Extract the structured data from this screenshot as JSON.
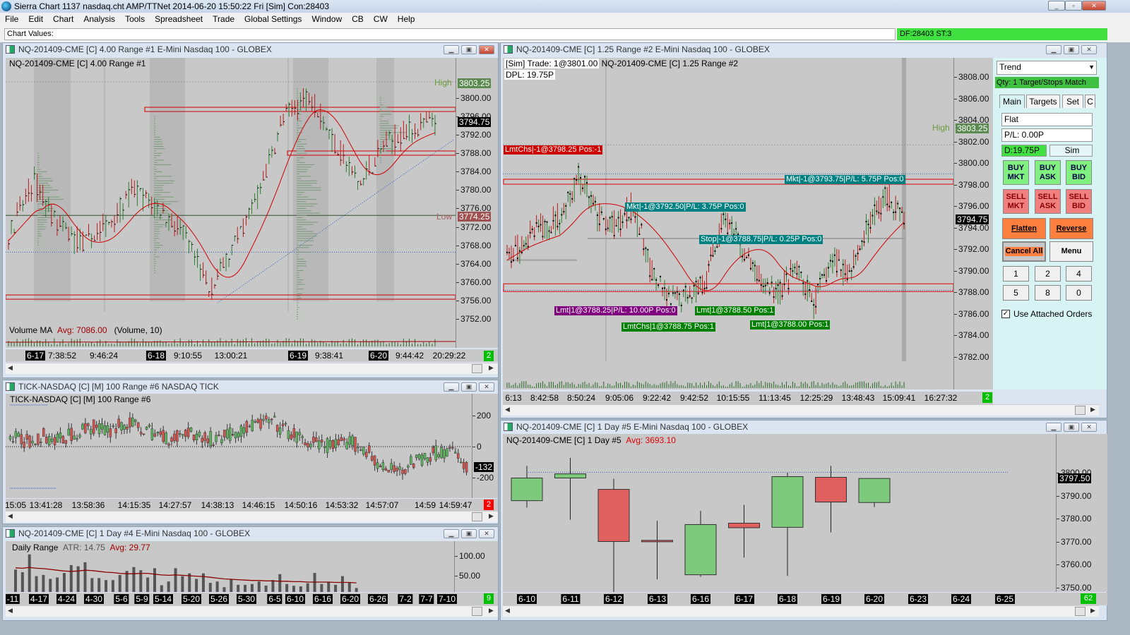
{
  "app": {
    "title": "Sierra Chart 1137 nasdaq.cht  AMP/TTNet 2014-06-20  15:50:22 Fri [Sim]  Con:28403"
  },
  "menu": [
    "File",
    "Edit",
    "Chart",
    "Analysis",
    "Tools",
    "Spreadsheet",
    "Trade",
    "Global Settings",
    "Window",
    "CB",
    "CW",
    "Help"
  ],
  "values_bar": {
    "label": "Chart Values:",
    "status": "DF:28403  ST:3"
  },
  "colors": {
    "chart_bg": "#c8c8c8",
    "up": "#2e7d32",
    "down": "#c62828",
    "candle_up": "#7dca7d",
    "candle_down": "#e06060",
    "teal": "#008080",
    "green_badge": "#00c000",
    "red_badge": "#ff0000"
  },
  "chart1": {
    "window_title": "NQ-201409-CME [C]  4.00 Range  #1  E-Mini Nasdaq 100 - GLOBEX",
    "header": "NQ-201409-CME [C]  4.00 Range  #1",
    "high_label": "High",
    "low_label": "Low",
    "y_ticks": [
      "3800.00",
      "3796.00",
      "3792.00",
      "3788.00",
      "3784.00",
      "3780.00",
      "3776.00",
      "3772.00",
      "3768.00",
      "3764.00",
      "3760.00",
      "3756.00",
      "3752.00"
    ],
    "markers": {
      "high": "3803.25",
      "last": "3794.75",
      "low": "3774.25"
    },
    "volume_label": "Volume MA",
    "volume_avg": "Avg: 7086.00",
    "volume_params": "(Volume, 10)",
    "time_labels": [
      {
        "t": "6-17",
        "d": true
      },
      {
        "t": "7:38:52"
      },
      {
        "t": "9:46:24"
      },
      {
        "t": "6-18",
        "d": true
      },
      {
        "t": "9:10:55"
      },
      {
        "t": "13:00:21"
      },
      {
        "t": "6-19",
        "d": true
      },
      {
        "t": "9:38:41"
      },
      {
        "t": "6-20",
        "d": true
      },
      {
        "t": "9:44:42"
      },
      {
        "t": "20:29:22"
      }
    ],
    "badge": "2",
    "price_path": [
      3770,
      3782,
      3772,
      3768,
      3773,
      3780,
      3776,
      3770,
      3758,
      3768,
      3780,
      3796,
      3801,
      3790,
      3781,
      3790,
      3793,
      3794.75
    ]
  },
  "chart2": {
    "window_title": "NQ-201409-CME [C]  1.25 Range  #2  E-Mini Nasdaq 100 - GLOBEX",
    "trade_text": "[Sim]  Trade: 1@3801.00",
    "header": "NQ-201409-CME [C]  1.25 Range  #2",
    "dpl": "DPL: 19.75P",
    "high_label": "High",
    "y_ticks": [
      "3808.00",
      "3806.00",
      "3804.00",
      "3802.00",
      "3800.00",
      "3798.00",
      "3796.00",
      "3794.00",
      "3792.00",
      "3790.00",
      "3788.00",
      "3786.00",
      "3784.00",
      "3782.00"
    ],
    "markers": {
      "high": "3803.25",
      "last": "3794.75"
    },
    "orders": [
      {
        "text": "LmtChs|-1@3798.25 Pos:-1",
        "color": "#d00000"
      },
      {
        "text": "Mkt|-1@3793.75|P/L: 5.75P Pos:0",
        "color": "#008080"
      },
      {
        "text": "Mkt|-1@3792.50|P/L: 3.75P Pos:0",
        "color": "#008080"
      },
      {
        "text": "Stop|-1@3788.75|P/L: 0.25P Pos:0",
        "color": "#008080"
      },
      {
        "text": "Lmt|1@3788.25|P/L: 10.00P Pos:0",
        "color": "#800080"
      },
      {
        "text": "Lmt|1@3788.50 Pos:1",
        "color": "#008000"
      },
      {
        "text": "LmtChs|1@3788.75 Pos:1",
        "color": "#008000"
      },
      {
        "text": "Lmt|1@3788.00 Pos:1",
        "color": "#008000"
      }
    ],
    "time_labels": [
      {
        "t": "6:13"
      },
      {
        "t": "8:42:58"
      },
      {
        "t": "8:50:24"
      },
      {
        "t": "9:05:06"
      },
      {
        "t": "9:22:42"
      },
      {
        "t": "9:42:52"
      },
      {
        "t": "10:15:55"
      },
      {
        "t": "11:13:45"
      },
      {
        "t": "12:25:29"
      },
      {
        "t": "13:48:43"
      },
      {
        "t": "15:09:41"
      },
      {
        "t": "16:27:32"
      }
    ],
    "badge": "2",
    "price_path": [
      3791,
      3793,
      3794,
      3795,
      3799,
      3795,
      3794,
      3796,
      3790,
      3787,
      3788,
      3789,
      3795,
      3792,
      3789,
      3788,
      3790,
      3787,
      3791,
      3790,
      3794,
      3797,
      3794.75
    ]
  },
  "trade_panel": {
    "strategy": "Trend",
    "qty_status": "Qty: 1 Target/Stops Match",
    "tabs": [
      "Main",
      "Targets",
      "Set",
      "C"
    ],
    "position": "Flat",
    "pl": "P/L: 0.00P",
    "daily": "D:19.75P",
    "mode": "Sim",
    "buttons": {
      "buy_mkt": [
        "BUY",
        "MKT"
      ],
      "buy_ask": [
        "BUY",
        "ASK"
      ],
      "buy_bid": [
        "BUY",
        "BID"
      ],
      "sell_mkt": [
        "SELL",
        "MKT"
      ],
      "sell_ask": [
        "SELL",
        "ASK"
      ],
      "sell_bid": [
        "SELL",
        "BID"
      ],
      "flatten": "Flatten",
      "reverse": "Reverse",
      "cancel_all": "Cancel All",
      "menu": "Menu"
    },
    "quantities": [
      "1",
      "2",
      "4",
      "5",
      "8",
      "0"
    ],
    "use_attached_orders": {
      "label": "Use Attached Orders",
      "checked": true
    }
  },
  "chart6": {
    "window_title": "TICK-NASDAQ [C] [M]  100 Range  #6  NASDAQ TICK",
    "header": "TICK-NASDAQ [C] [M]  100 Range  #6",
    "y_ticks": [
      "200",
      "0",
      "-200"
    ],
    "marker": "-132",
    "time_labels": [
      {
        "t": "15:05"
      },
      {
        "t": "13:41:28"
      },
      {
        "t": "13:58:36"
      },
      {
        "t": "14:15:35"
      },
      {
        "t": "14:27:57"
      },
      {
        "t": "14:38:13"
      },
      {
        "t": "14:46:15"
      },
      {
        "t": "14:50:16"
      },
      {
        "t": "14:53:32"
      },
      {
        "t": "14:57:07"
      },
      {
        "t": "14:59"
      },
      {
        "t": "14:59:47"
      }
    ],
    "badge": "2",
    "value_path": [
      60,
      30,
      70,
      40,
      90,
      130,
      100,
      150,
      120,
      80,
      50,
      100,
      40,
      70,
      100,
      140,
      160,
      100,
      30,
      20,
      0,
      30,
      -40,
      -160,
      -140,
      -90,
      -40,
      -20,
      -132
    ]
  },
  "chart4": {
    "window_title": "NQ-201409-CME [C]  1 Day   #4  E-Mini Nasdaq 100 - GLOBEX",
    "label": "Daily Range",
    "atr": "ATR: 14.75",
    "avg": "Avg: 29.77",
    "y_ticks": [
      "100.00",
      "50.00"
    ],
    "time_labels": [
      {
        "t": "-11",
        "d": true
      },
      {
        "t": "4-17",
        "d": true
      },
      {
        "t": "4-24",
        "d": true
      },
      {
        "t": "4-30",
        "d": true
      },
      {
        "t": "5-6",
        "d": true
      },
      {
        "t": "5-9",
        "d": true
      },
      {
        "t": "5-14",
        "d": true
      },
      {
        "t": "5-20",
        "d": true
      },
      {
        "t": "5-26",
        "d": true
      },
      {
        "t": "5-30",
        "d": true
      },
      {
        "t": "6-5",
        "d": true
      },
      {
        "t": "6-10",
        "d": true
      },
      {
        "t": "6-16",
        "d": true
      },
      {
        "t": "6-20",
        "d": true
      },
      {
        "t": "6-26",
        "d": true
      },
      {
        "t": "7-2",
        "d": true
      },
      {
        "t": "7-7",
        "d": true
      },
      {
        "t": "7-10",
        "d": true
      }
    ],
    "badge": "9",
    "chart_data": {
      "type": "bar",
      "ylim": [
        0,
        110
      ],
      "values": [
        65.6,
        59,
        104,
        49,
        52,
        42,
        45.5,
        57,
        77,
        74,
        84,
        44,
        44,
        39,
        39,
        52,
        62,
        72,
        64,
        45.5,
        69,
        26,
        35.5,
        69,
        49,
        56,
        42,
        56,
        32,
        35.5,
        21,
        41,
        27,
        27,
        29,
        35.5,
        25,
        39,
        54,
        29,
        24.5,
        23,
        31,
        57,
        29,
        33,
        27,
        49,
        33,
        19
      ],
      "avg_line": [
        70,
        69,
        71,
        69,
        68,
        66,
        64,
        62,
        61,
        62,
        64,
        63,
        61,
        59,
        58,
        56,
        55,
        55,
        56,
        56,
        54,
        52,
        51,
        52,
        51,
        50,
        49,
        48,
        46,
        44,
        42,
        41,
        40,
        39,
        38,
        38,
        37,
        37,
        36,
        36,
        35,
        35,
        34,
        34,
        34,
        34,
        33,
        33,
        33,
        32
      ]
    }
  },
  "chart5": {
    "window_title": "NQ-201409-CME [C]  1 Day   #5  E-Mini Nasdaq 100 - GLOBEX",
    "header": "NQ-201409-CME [C]  1 Day   #5",
    "avg": "Avg: 3693.10",
    "y_ticks": [
      "3800.00",
      "3790.00",
      "3780.00",
      "3770.00",
      "3760.00",
      "3750.00"
    ],
    "marker": "3797.50",
    "time_labels": [
      {
        "t": "6-10",
        "d": true
      },
      {
        "t": "6-11",
        "d": true
      },
      {
        "t": "6-12",
        "d": true
      },
      {
        "t": "6-13",
        "d": true
      },
      {
        "t": "6-16",
        "d": true
      },
      {
        "t": "6-17",
        "d": true
      },
      {
        "t": "6-18",
        "d": true
      },
      {
        "t": "6-19",
        "d": true
      },
      {
        "t": "6-20",
        "d": true
      },
      {
        "t": "6-23",
        "d": true
      },
      {
        "t": "6-24",
        "d": true
      },
      {
        "t": "6-25",
        "d": true
      }
    ],
    "badge": "62",
    "chart_data": {
      "type": "candlestick",
      "ylim": [
        3745,
        3808
      ],
      "candles": [
        {
          "date": "6-10",
          "o": 3787.8,
          "h": 3803,
          "l": 3784.8,
          "c": 3797.7
        },
        {
          "date": "6-11",
          "o": 3797.7,
          "h": 3806.5,
          "l": 3779.5,
          "c": 3799.5
        },
        {
          "date": "6-12",
          "o": 3792.75,
          "h": 3797.4,
          "l": 3744.8,
          "c": 3770
        },
        {
          "date": "6-13",
          "o": 3770.5,
          "h": 3779,
          "l": 3753.5,
          "c": 3770
        },
        {
          "date": "6-16",
          "o": 3755.5,
          "h": 3783.3,
          "l": 3754.6,
          "c": 3777.4
        },
        {
          "date": "6-17",
          "o": 3778,
          "h": 3786,
          "l": 3763,
          "c": 3776
        },
        {
          "date": "6-18",
          "o": 3776.2,
          "h": 3800,
          "l": 3755,
          "c": 3798.3
        },
        {
          "date": "6-19",
          "o": 3798,
          "h": 3803,
          "l": 3774,
          "c": 3787.2
        },
        {
          "date": "6-20",
          "o": 3787,
          "h": 3797.5,
          "l": 3785,
          "c": 3797.5
        }
      ]
    }
  }
}
